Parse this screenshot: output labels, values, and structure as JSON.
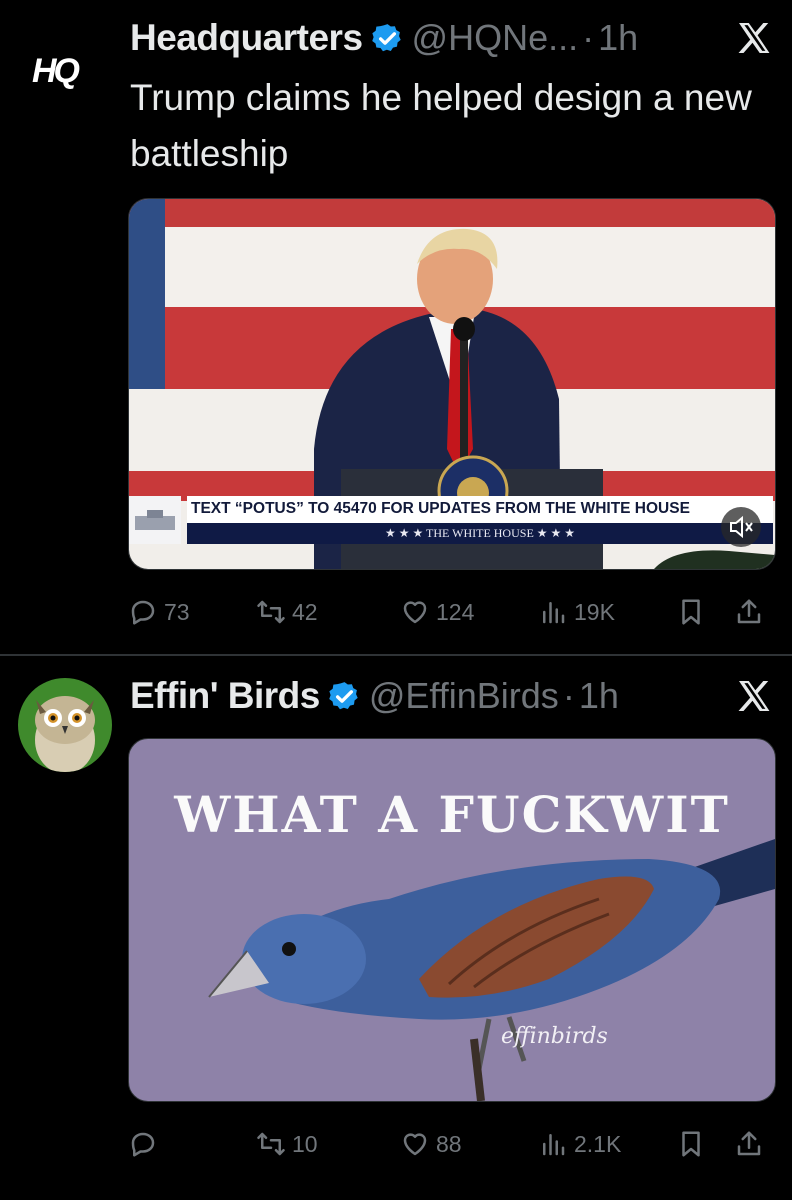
{
  "tweets": [
    {
      "account_name": "Headquarters",
      "handle": "@HQNe...",
      "separator": "·",
      "time": "1h",
      "avatar_text": "HQ",
      "text": "Trump claims he helped design a new battleship",
      "media": {
        "banner_text": "TEXT “POTUS” TO 45470 FOR UPDATES FROM THE WHITE HOUSE",
        "banner_subtext": "★ ★ ★   THE WHITE HOUSE   ★ ★ ★",
        "seal_text": "PRESIDENT OF THE UNITED",
        "mute_icon": "speaker-muted-icon"
      },
      "actions": {
        "replies": "73",
        "reposts": "42",
        "likes": "124",
        "views": "19K"
      }
    },
    {
      "account_name": "Effin' Birds",
      "handle": "@EffinBirds",
      "separator": "·",
      "time": "1h",
      "text": "",
      "media": {
        "meme_text": "WHAT A FUCKWIT",
        "signature": "effinbirds"
      },
      "actions": {
        "replies": "",
        "reposts": "10",
        "likes": "88",
        "views": "2.1K"
      }
    }
  ],
  "colors": {
    "background": "#000000",
    "text_primary": "#e7e9ea",
    "text_secondary": "#71767b",
    "verified_blue": "#1d9bf0",
    "divider": "#2f3336",
    "meme_background": "#8e82a8"
  }
}
